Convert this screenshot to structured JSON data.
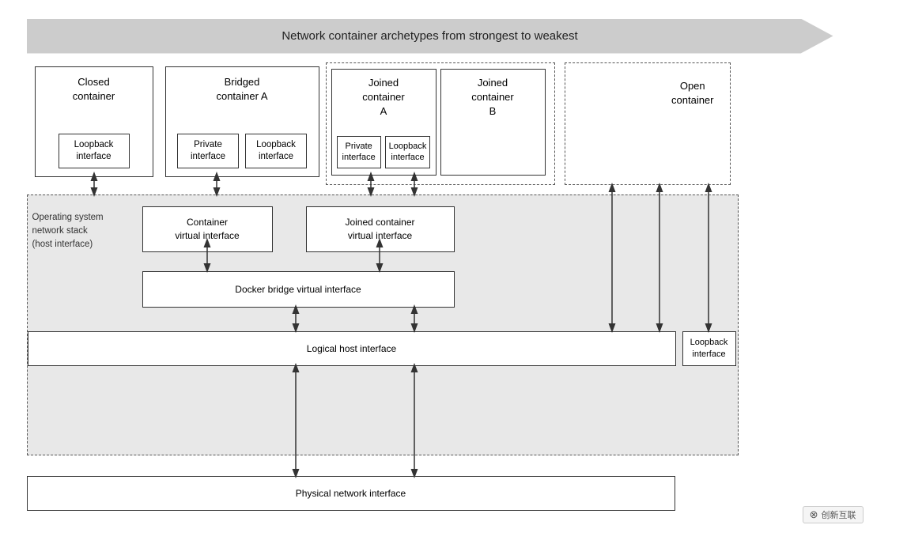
{
  "diagram": {
    "arrow_label": "Network container archetypes from strongest to weakest",
    "containers": [
      {
        "id": "closed",
        "title": "Closed\ncontainer",
        "interfaces": [
          "Loopback\ninterface"
        ]
      },
      {
        "id": "bridged",
        "title": "Bridged\ncontainer A",
        "interfaces": [
          "Private\ninterface",
          "Loopback\ninterface"
        ]
      },
      {
        "id": "joined-a",
        "title": "Joined\ncontainer\nA",
        "interfaces": [
          "Private\ninterface",
          "Loopback\ninterface"
        ]
      },
      {
        "id": "joined-b",
        "title": "Joined\ncontainer\nB",
        "interfaces": []
      },
      {
        "id": "open",
        "title": "Open\ncontainer",
        "interfaces": []
      }
    ],
    "virt_interfaces": [
      "Container\nvirtual interface",
      "Joined container\nvirtual interface"
    ],
    "docker_bridge": "Docker bridge virtual interface",
    "logical_host": "Logical host interface",
    "loopback_host": "Loopback\ninterface",
    "physical": "Physical network interface",
    "os_label": "Operating system\nnetwork stack\n(host interface)",
    "watermark": "创新互联"
  }
}
